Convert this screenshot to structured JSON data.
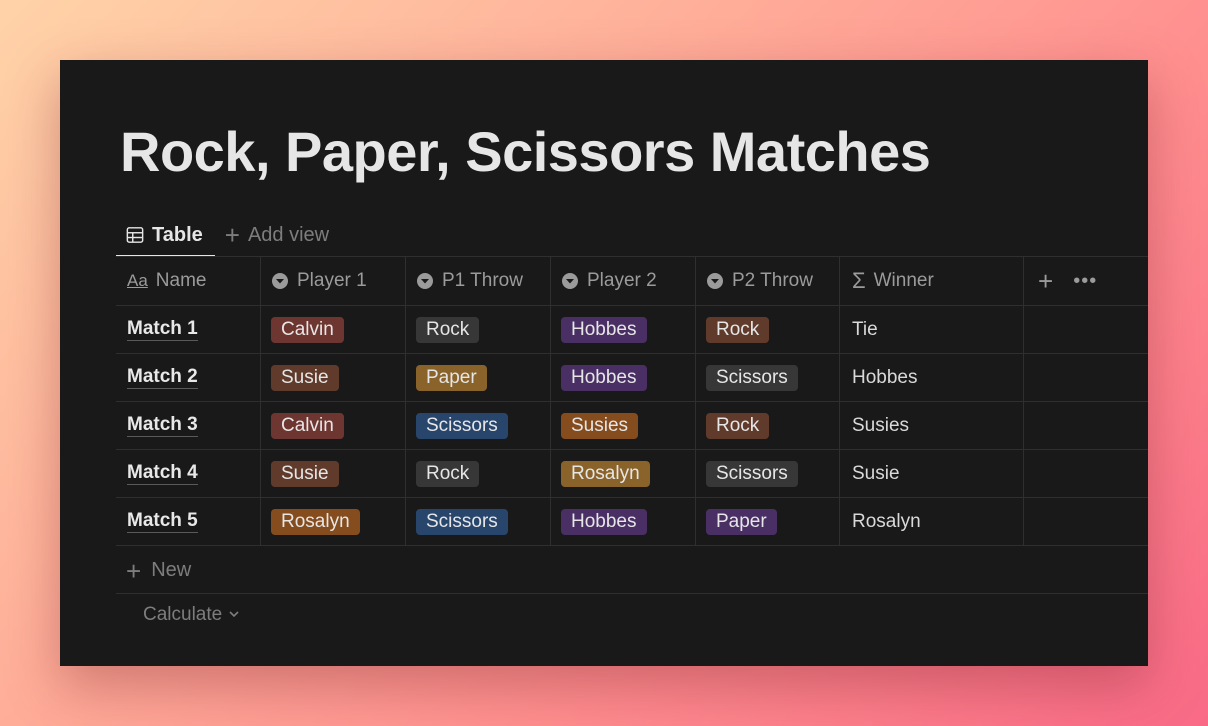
{
  "page": {
    "title": "Rock, Paper, Scissors Matches"
  },
  "views": {
    "active_tab": "Table",
    "add_view_label": "Add view"
  },
  "columns": {
    "name": "Name",
    "player1": "Player 1",
    "p1_throw": "P1 Throw",
    "player2": "Player 2",
    "p2_throw": "P2 Throw",
    "winner": "Winner"
  },
  "rows": [
    {
      "name": "Match 1",
      "player1": "Calvin",
      "p1_throw": "Rock",
      "player2": "Hobbes",
      "p2_throw": "Rock",
      "winner": "Tie"
    },
    {
      "name": "Match 2",
      "player1": "Susie",
      "p1_throw": "Paper",
      "player2": "Hobbes",
      "p2_throw": "Scissors",
      "winner": "Hobbes"
    },
    {
      "name": "Match 3",
      "player1": "Calvin",
      "p1_throw": "Scissors",
      "player2": "Susies",
      "p2_throw": "Rock",
      "winner": "Susies"
    },
    {
      "name": "Match 4",
      "player1": "Susie",
      "p1_throw": "Rock",
      "player2": "Rosalyn",
      "p2_throw": "Scissors",
      "winner": "Susie"
    },
    {
      "name": "Match 5",
      "player1": "Rosalyn",
      "p1_throw": "Scissors",
      "player2": "Hobbes",
      "p2_throw": "Paper",
      "winner": "Rosalyn"
    }
  ],
  "footer": {
    "new_label": "New",
    "calculate_label": "Calculate"
  },
  "colors": {
    "background": "#191919",
    "tag_gray": "#373737",
    "tag_red": "#6e3630",
    "tag_brown": "#603b2c",
    "tag_purple": "#492f64",
    "tag_orange": "#854c1d",
    "tag_yellow": "#89632a",
    "tag_blue": "#28456c"
  }
}
